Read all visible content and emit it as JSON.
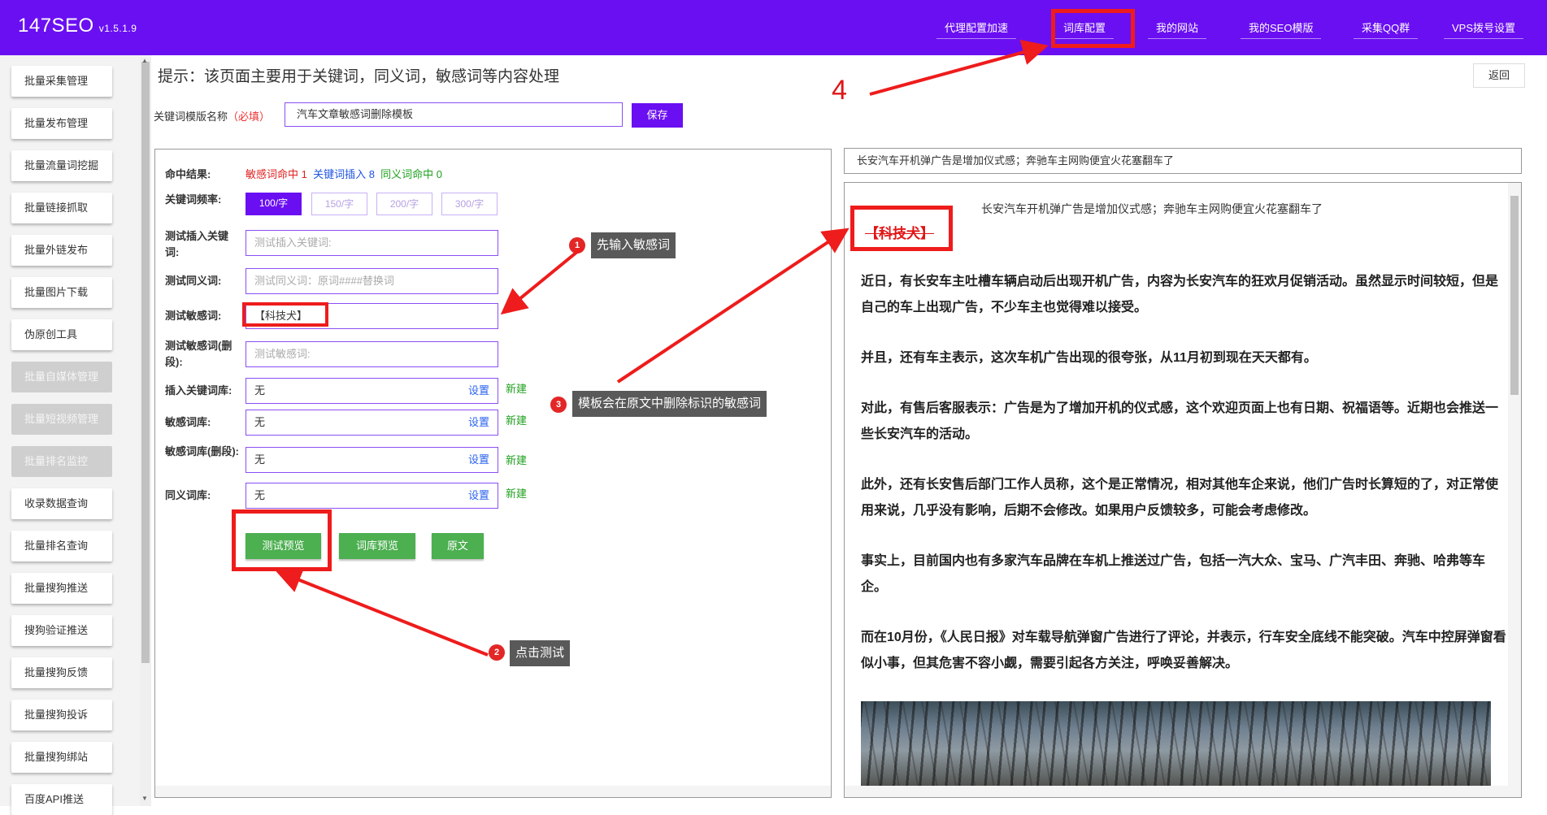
{
  "app": {
    "name": "147SEO",
    "version": "v1.5.1.9"
  },
  "nav": [
    "代理配置加速",
    "词库配置",
    "我的网站",
    "我的SEO模版",
    "采集QQ群",
    "VPS拨号设置"
  ],
  "sidebar": [
    {
      "label": "批量采集管理",
      "enabled": true
    },
    {
      "label": "批量发布管理",
      "enabled": true
    },
    {
      "label": "批量流量词挖掘",
      "enabled": true
    },
    {
      "label": "批量链接抓取",
      "enabled": true
    },
    {
      "label": "批量外链发布",
      "enabled": true
    },
    {
      "label": "批量图片下载",
      "enabled": true
    },
    {
      "label": "伪原创工具",
      "enabled": true
    },
    {
      "label": "批量自媒体管理",
      "enabled": false
    },
    {
      "label": "批量短视频管理",
      "enabled": false
    },
    {
      "label": "批量排名监控",
      "enabled": false
    },
    {
      "label": "收录数据查询",
      "enabled": true
    },
    {
      "label": "批量排名查询",
      "enabled": true
    },
    {
      "label": "批量搜狗推送",
      "enabled": true
    },
    {
      "label": "搜狗验证推送",
      "enabled": true
    },
    {
      "label": "批量搜狗反馈",
      "enabled": true
    },
    {
      "label": "批量搜狗投诉",
      "enabled": true
    },
    {
      "label": "批量搜狗绑站",
      "enabled": true
    },
    {
      "label": "百度API推送",
      "enabled": true
    }
  ],
  "hint": "提示：该页面主要用于关键词，同义词，敏感词等内容处理",
  "back": "返回",
  "template": {
    "label": "关键词模版名称",
    "required": "（必填）",
    "value": "汽车文章敏感词删除模板",
    "save": "保存"
  },
  "form": {
    "result_label": "命中结果:",
    "result_sensitive": "敏感词命中 1",
    "result_keyword": "关键词插入 8",
    "result_synonym": "同义词命中 0",
    "freq_label": "关键词频率:",
    "freq_options": [
      "100/字",
      "150/字",
      "200/字",
      "300/字"
    ],
    "test_keyword_label": "测试插入关键词:",
    "test_keyword_placeholder": "测试插入关键词:",
    "test_synonym_label": "测试同义词:",
    "test_synonym_placeholder": "测试同义词：原词####替换词",
    "test_sensitive_label": "测试敏感词:",
    "test_sensitive_value": "【科技犬】",
    "test_sensitive_del_label": "测试敏感词(删段):",
    "test_sensitive_del_placeholder": "测试敏感词:",
    "insert_lib_label": "插入关键词库:",
    "sensitive_lib_label": "敏感词库:",
    "sensitive_del_lib_label": "敏感词库(删段):",
    "synonym_lib_label": "同义词库:",
    "lib_value": "无",
    "set_label": "设置",
    "new_label": "新建",
    "btn_test": "测试预览",
    "btn_lib": "词库预览",
    "btn_orig": "原文"
  },
  "preview": {
    "title": "长安汽车开机弹广告是增加仪式感；奔驰车主网购便宜火花塞翻车了",
    "tag": "【科技犬】",
    "paragraphs": [
      "近日，有长安车主吐槽车辆启动后出现开机广告，内容为长安汽车的狂欢月促销活动。虽然显示时间较短，但是自己的车上出现广告，不少车主也觉得难以接受。",
      "并且，还有车主表示，这次车机广告出现的很夸张，从11月初到现在天天都有。",
      "对此，有售后客服表示：广告是为了增加开机的仪式感，这个欢迎页面上也有日期、祝福语等。近期也会推送一些长安汽车的活动。",
      "此外，还有长安售后部门工作人员称，这个是正常情况，相对其他车企来说，他们广告时长算短的了，对正常使用来说，几乎没有影响，后期不会修改。如果用户反馈较多，可能会考虑修改。",
      "事实上，目前国内也有多家汽车品牌在车机上推送过广告，包括一汽大众、宝马、广汽丰田、奔驰、哈弗等车企。",
      "而在10月份，《人民日报》对车载导航弹窗广告进行了评论，并表示，行车安全底线不能突破。汽车中控屏弹窗看似小事，但其危害不容小觑，需要引起各方关注，呼唤妥善解决。"
    ]
  },
  "annotations": {
    "step1_num": "1",
    "step1": "先输入敏感词",
    "step2_num": "2",
    "step2": "点击测试",
    "step3_num": "3",
    "step3": "模板会在原文中删除标识的敏感词",
    "step4": "4"
  },
  "colors": {
    "brand": "#6a0ff2",
    "highlight": "#ee1c1c",
    "green": "#4caf50"
  }
}
